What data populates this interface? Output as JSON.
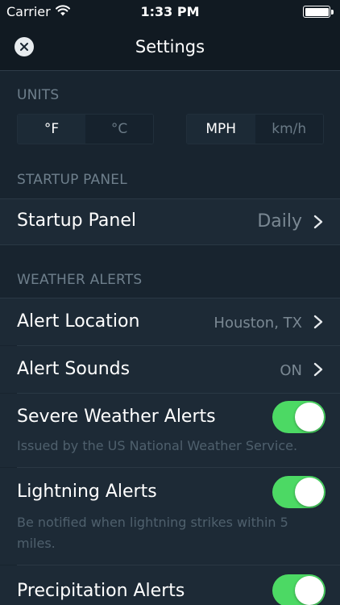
{
  "status_bar": {
    "carrier": "Carrier",
    "time": "1:33 PM"
  },
  "nav": {
    "title": "Settings",
    "close_icon": "close-icon"
  },
  "units": {
    "header": "UNITS",
    "temperature": {
      "options": [
        "°F",
        "°C"
      ],
      "selected": "°F"
    },
    "speed": {
      "options": [
        "MPH",
        "km/h"
      ],
      "selected": "MPH"
    }
  },
  "startup": {
    "header": "STARTUP PANEL",
    "row": {
      "label": "Startup Panel",
      "value": "Daily"
    }
  },
  "alerts": {
    "header": "WEATHER ALERTS",
    "location": {
      "label": "Alert Location",
      "value": "Houston, TX"
    },
    "sounds": {
      "label": "Alert Sounds",
      "value": "ON"
    },
    "severe": {
      "label": "Severe Weather Alerts",
      "sub": "Issued by the US National Weather Service.",
      "on": true
    },
    "lightning": {
      "label": "Lightning Alerts",
      "sub": "Be notified when lightning strikes within 5 miles.",
      "on": true
    },
    "precipitation": {
      "label": "Precipitation Alerts",
      "on": true
    }
  },
  "colors": {
    "background": "#18242f",
    "toggle_on": "#4cd964",
    "secondary_text": "#6e7f8c"
  }
}
